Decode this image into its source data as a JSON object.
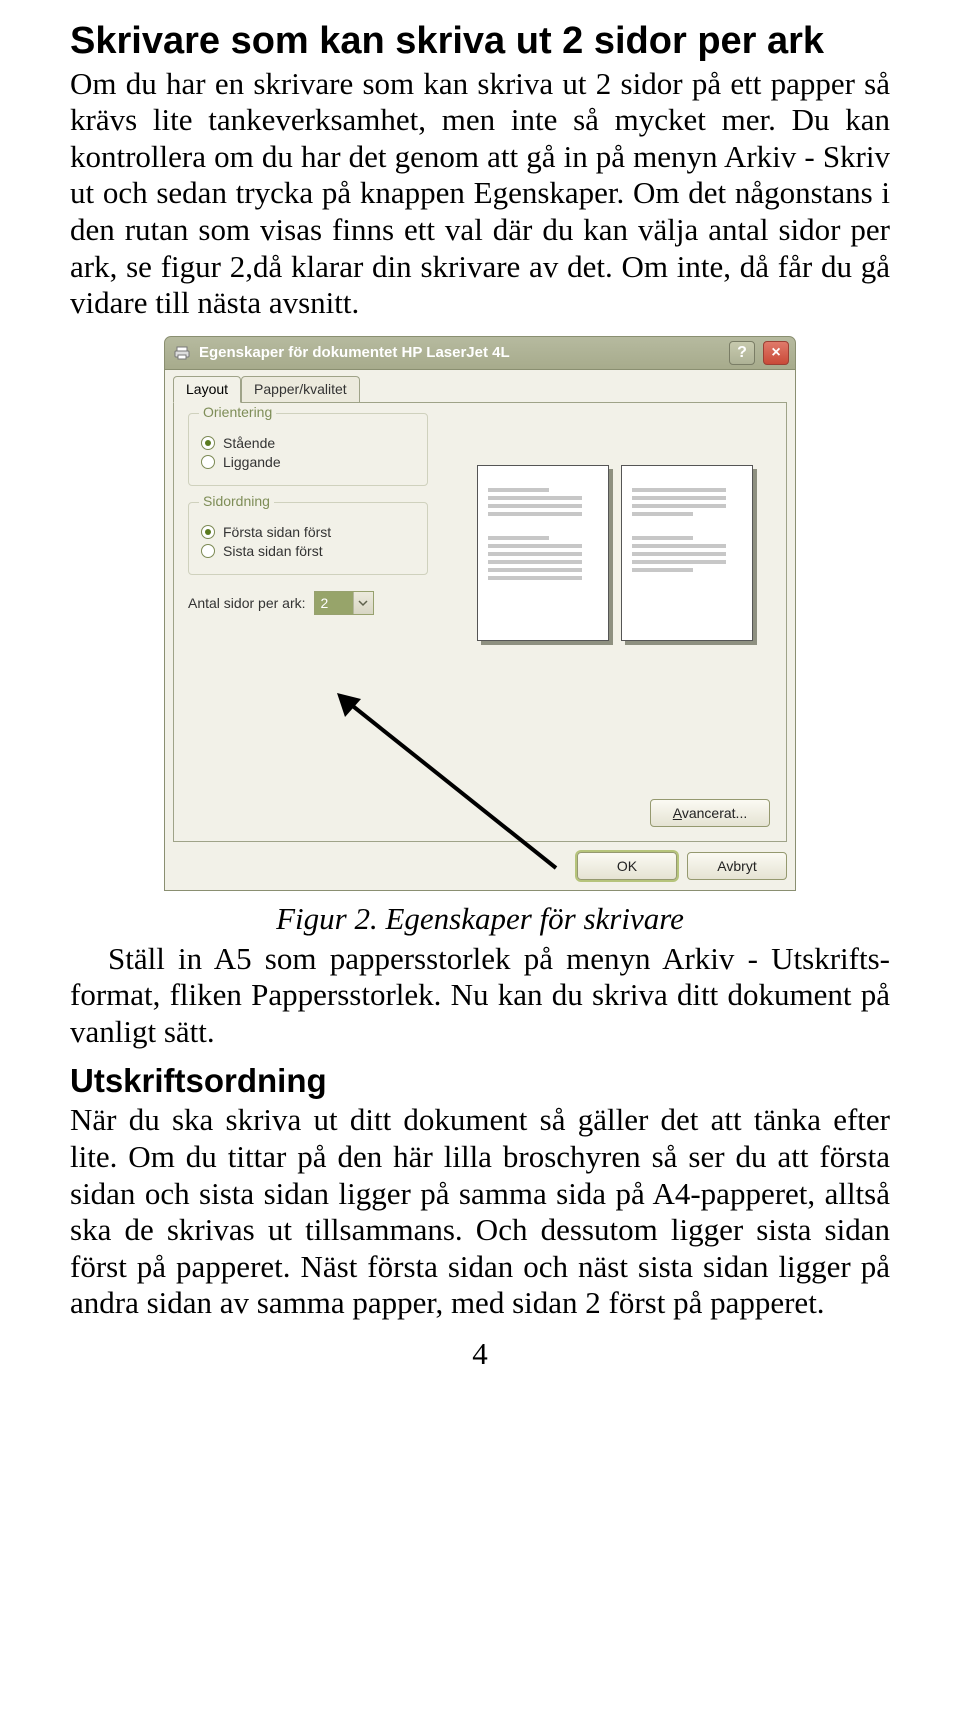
{
  "heading": "Skrivare som kan skriva ut 2 sidor per ark",
  "para1": "Om du har en skrivare som kan skriva ut 2 sidor på ett papper så krävs lite tankeverksamhet, men inte så mycket mer. Du kan kontrollera om du har det genom att gå in på menyn Arkiv - Skriv ut och sedan trycka på knappen Egenskaper. Om det någonstans i den rutan som visas finns ett val där du kan välja antal sidor per ark, se figur 2,då klarar din skrivare av det. Om inte, då får du gå vidare till nästa avsnitt.",
  "dialog": {
    "title": "Egenskaper för dokumentet HP LaserJet 4L",
    "helpLabel": "?",
    "closeLabel": "×",
    "tabs": {
      "layout": "Layout",
      "paper": "Papper/kvalitet"
    },
    "orientation": {
      "legend": "Orientering",
      "portrait": "Stående",
      "landscape": "Liggande"
    },
    "pageOrder": {
      "legend": "Sidordning",
      "first": "Första sidan först",
      "last": "Sista sidan först"
    },
    "pagesPerSheet": {
      "label": "Antal sidor per ark:",
      "value": "2"
    },
    "advanced": "Avancerat...",
    "ok": "OK",
    "cancel": "Avbryt"
  },
  "caption": "Figur 2. Egenskaper för skrivare",
  "para2": "Ställ in A5 som pappersstorlek på menyn Arkiv - Utskrifts­format, fliken Pappersstorlek. Nu kan du skriva ditt dokument på vanligt sätt.",
  "subheading": "Utskriftsordning",
  "para3": "När du ska skriva ut ditt dokument så gäller det att tänka efter lite. Om du tittar på den här lilla broschyren så ser du att första sidan och sista sidan ligger på samma sida på A4-papperet, alltså ska de skrivas ut tillsammans. Och dessutom ligger sista sidan först på papperet. Näst första sidan och näst sista sidan ligger på andra sidan av samma papper, med sidan 2 först på papperet.",
  "pageNumber": "4"
}
